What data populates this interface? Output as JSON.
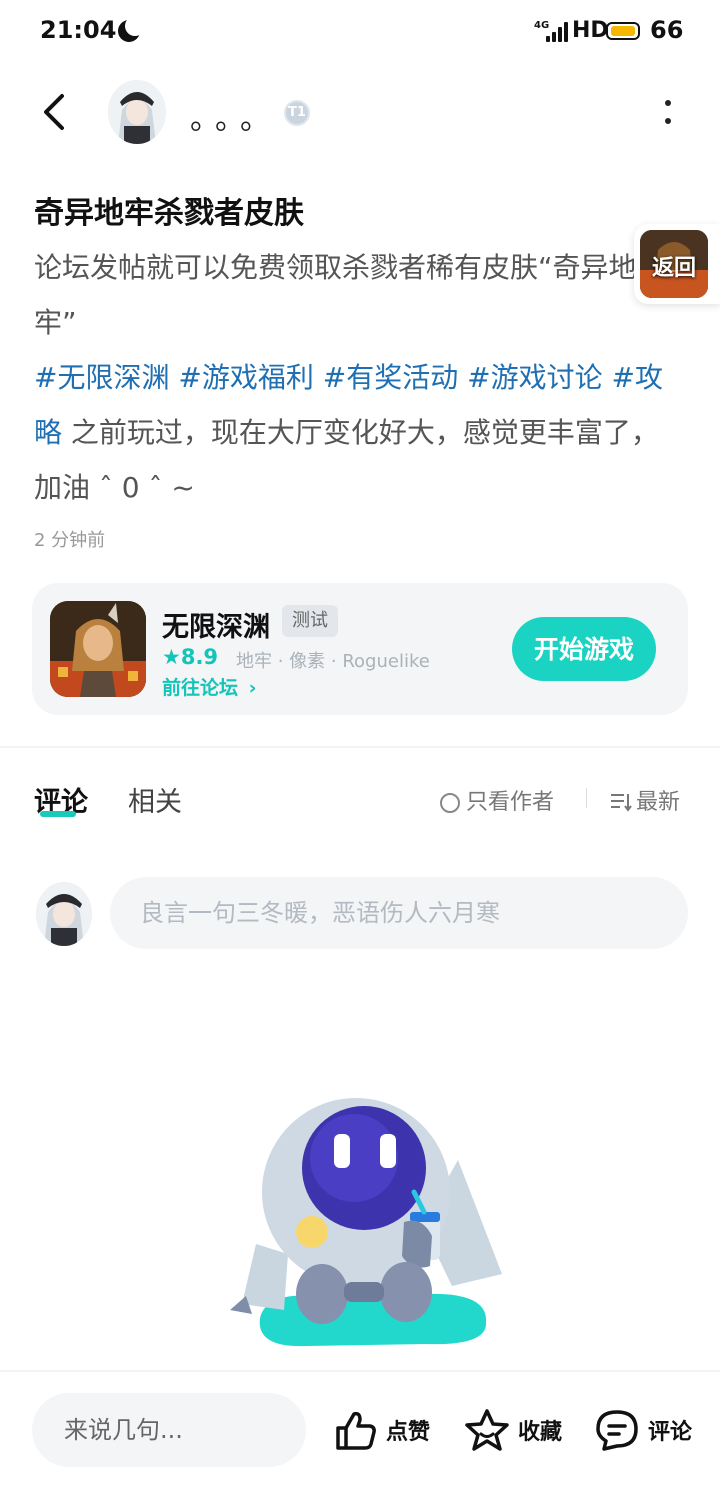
{
  "status_bar": {
    "time": "21:04",
    "signal": "4G",
    "hd": "HD",
    "battery": "66"
  },
  "header": {
    "author_name": "。。。",
    "level_badge": "T1"
  },
  "post": {
    "title": "奇异地牢杀戮者皮肤",
    "body_line1": "论坛发帖就可以免费领取杀戮者稀有皮肤“奇异地牢”",
    "hashtags": [
      "#无限深渊",
      "#游戏福利",
      "#有奖活动",
      "#游戏讨论",
      "#攻略"
    ],
    "body_line2": " 之前玩过，现在大厅变化好大，感觉更丰富了，加油 ˆ 0 ˆ ~",
    "time": "2 分钟前"
  },
  "float_return": {
    "label": "返回"
  },
  "game_card": {
    "name": "无限深渊",
    "tag": "测试",
    "rating": "8.9",
    "genres": "地牢 · 像素 · Roguelike",
    "forum_link": "前往论坛",
    "play_button": "开始游戏"
  },
  "tabs": {
    "comments": "评论",
    "related": "相关",
    "only_author": "只看作者",
    "sort": "最新"
  },
  "comment_input": {
    "placeholder": "良言一句三冬暖，恶语伤人六月寒"
  },
  "bottom_bar": {
    "say_placeholder": "来说几句...",
    "like": "点赞",
    "favorite": "收藏",
    "comment": "评论"
  },
  "colors": {
    "accent": "#1bd3c3",
    "hashtag": "#1f6fb2"
  }
}
